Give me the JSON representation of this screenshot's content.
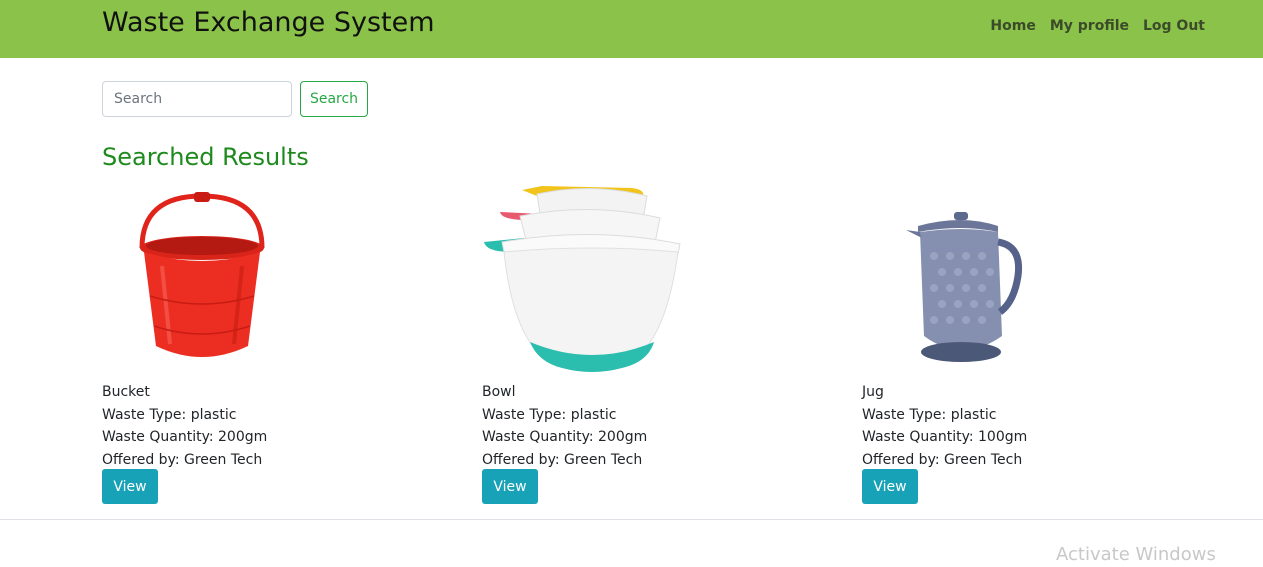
{
  "navbar": {
    "brand": "Waste Exchange System",
    "links": [
      "Home",
      "My profile",
      "Log Out"
    ],
    "color": "#8bc34a"
  },
  "search": {
    "placeholder": "Search",
    "value": "",
    "button_label": "Search"
  },
  "results": {
    "title": "Searched Results",
    "items": [
      {
        "name": "Bucket",
        "type": "Waste Type: plastic",
        "quantity": "Waste Quantity: 200gm",
        "offered_by": "Offered by: Green Tech",
        "button": "View",
        "image": "red-bucket-image"
      },
      {
        "name": "Bowl",
        "type": "Waste Type: plastic",
        "quantity": "Waste Quantity: 200gm",
        "offered_by": "Offered by: Green Tech",
        "button": "View",
        "image": "mixing-bowls-image"
      },
      {
        "name": "Jug",
        "type": "Waste Type: plastic",
        "quantity": "Waste Quantity: 100gm",
        "offered_by": "Offered by: Green Tech",
        "button": "View",
        "image": "glass-jug-image"
      }
    ]
  },
  "watermark": "Activate Windows"
}
